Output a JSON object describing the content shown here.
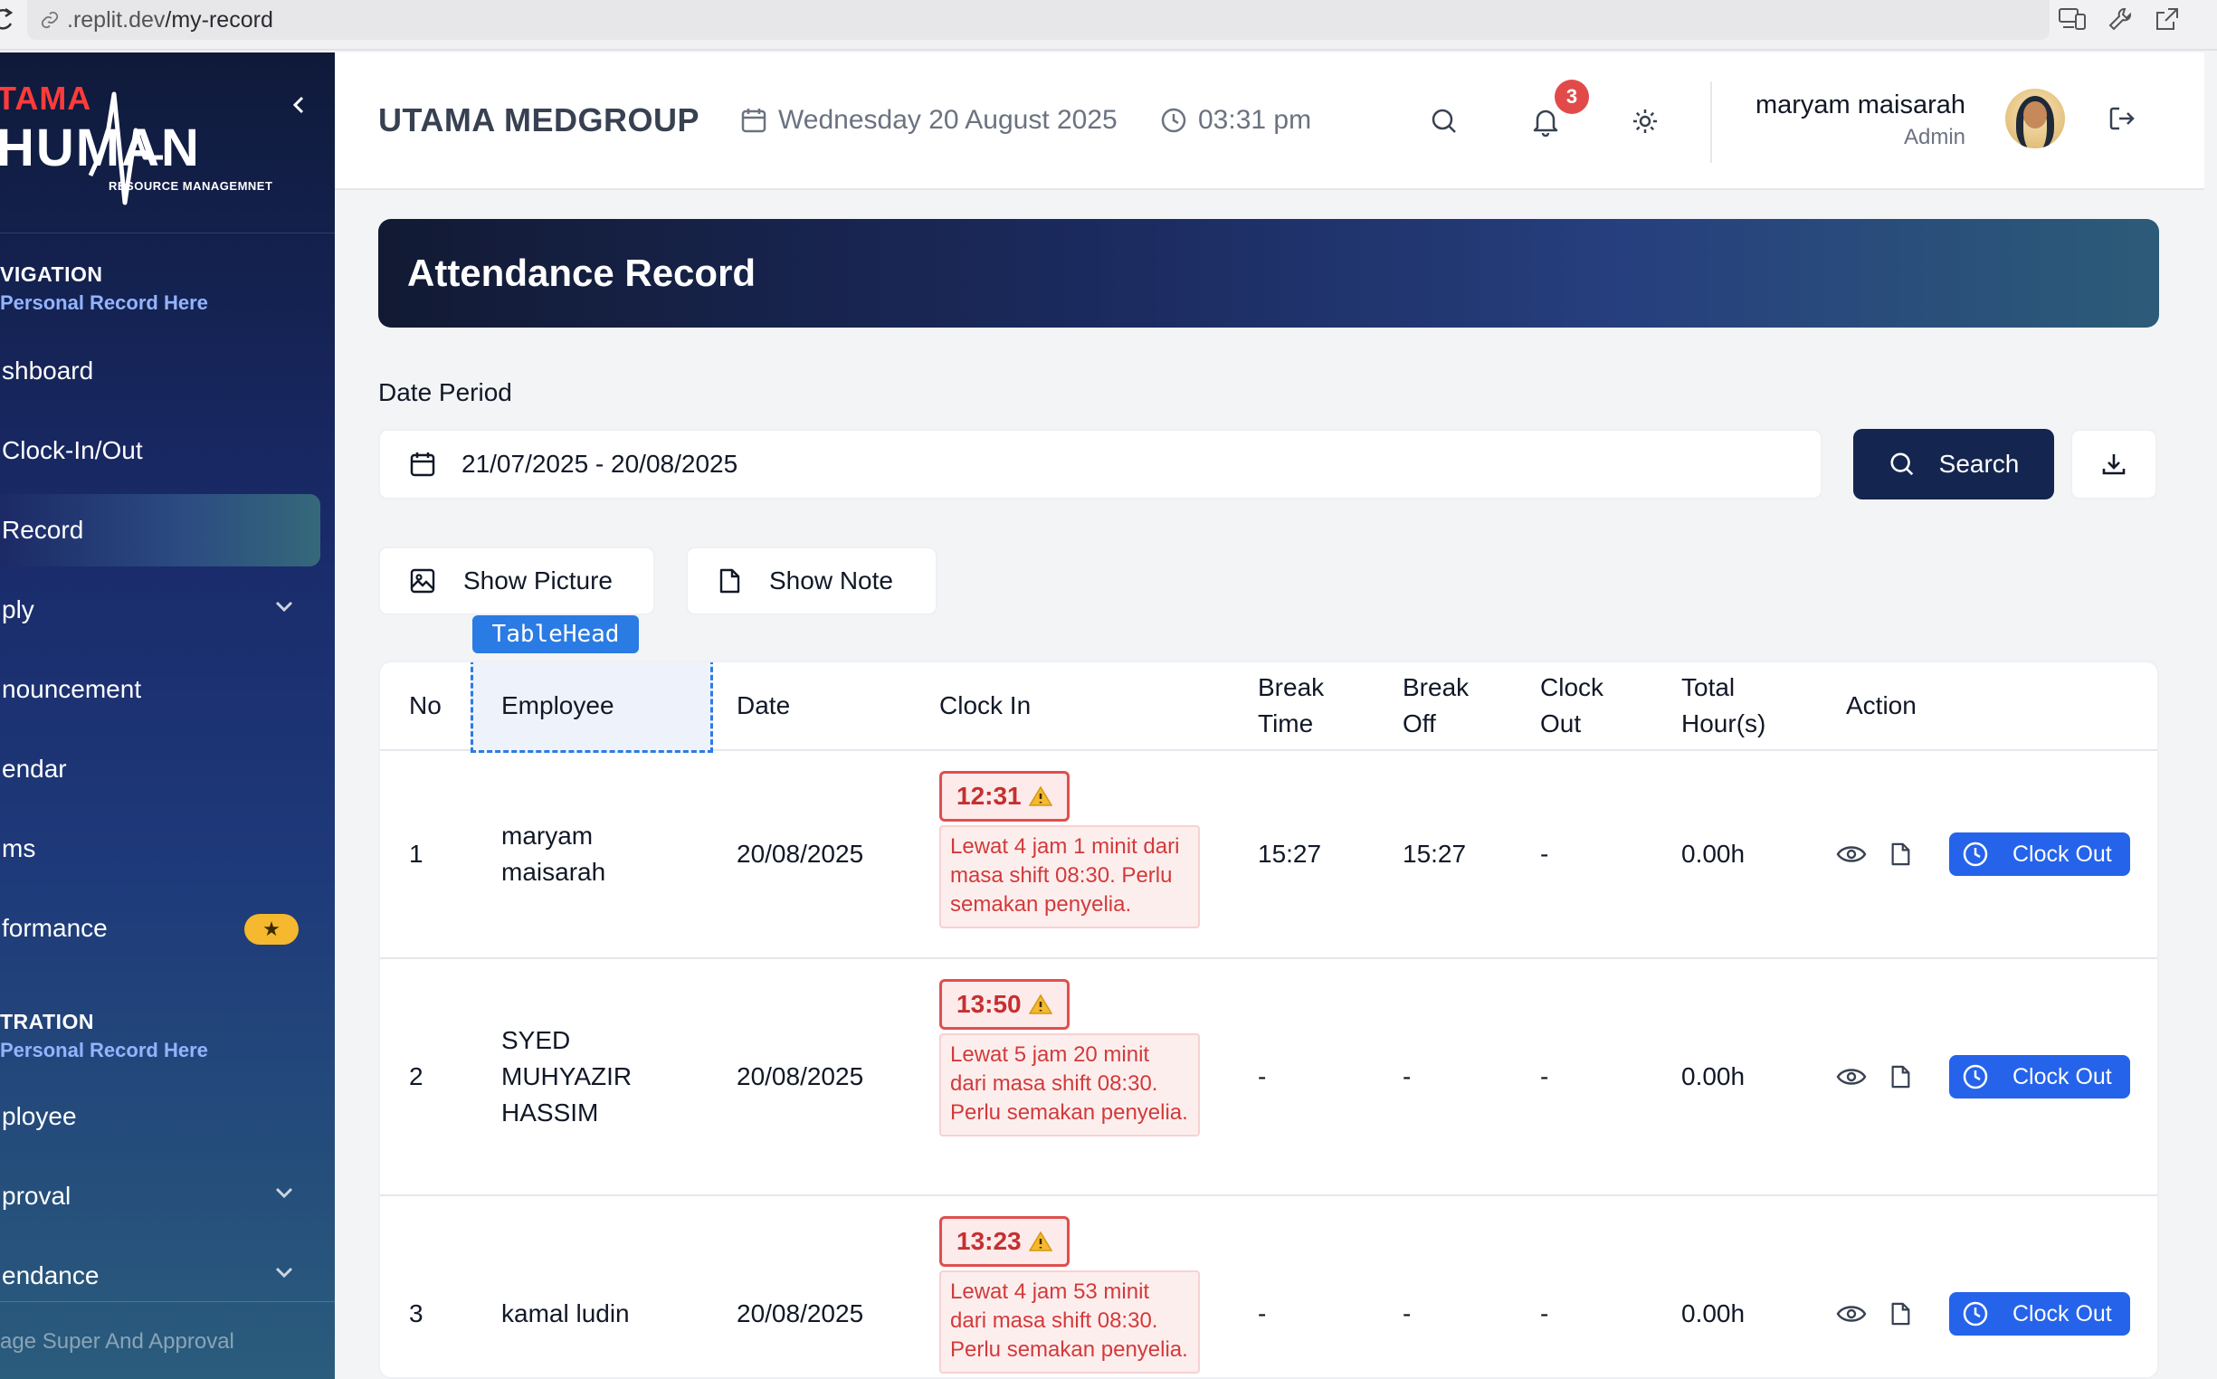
{
  "browser": {
    "url_prefix": ".replit.dev",
    "url_path": "/my-record"
  },
  "sidebar": {
    "brand": {
      "top": "TAMA",
      "main": "HUMAN",
      "sub": "RESOURCE MANAGEMNET"
    },
    "nav_title": "VIGATION",
    "nav_subtitle": "Personal Record Here",
    "items": [
      {
        "label": "shboard"
      },
      {
        "label": "Clock-In/Out"
      },
      {
        "label": "Record",
        "active": true
      },
      {
        "label": "ply",
        "has_chevron": true
      },
      {
        "label": "nouncement"
      },
      {
        "label": "endar"
      },
      {
        "label": "ms"
      },
      {
        "label": "formance",
        "badge_icon": "star-icon"
      }
    ],
    "admin_title": "TRATION",
    "admin_subtitle": "Personal Record Here",
    "admin_items": [
      {
        "label": "ployee"
      },
      {
        "label": "proval",
        "has_chevron": true
      },
      {
        "label": "endance",
        "has_chevron": true
      }
    ],
    "footer": "age Super And Approval"
  },
  "header": {
    "company": "UTAMA MEDGROUP",
    "date": "Wednesday 20 August 2025",
    "time": "03:31 pm",
    "notifications": "3",
    "user_name": "maryam maisarah",
    "user_role": "Admin"
  },
  "page": {
    "title": "Attendance Record",
    "date_period_label": "Date Period",
    "date_range": "21/07/2025 - 20/08/2025",
    "search_label": "Search",
    "show_picture_label": "Show Picture",
    "show_note_label": "Show Note",
    "dev_overlay_label": "TableHead"
  },
  "table": {
    "headers": {
      "no": "No",
      "employee": "Employee",
      "date": "Date",
      "clock_in": "Clock In",
      "break_time_1": "Break",
      "break_time_2": "Time",
      "break_off_1": "Break",
      "break_off_2": "Off",
      "clock_out_1": "Clock",
      "clock_out_2": "Out",
      "total_1": "Total",
      "total_2": "Hour(s)",
      "action": "Action"
    },
    "rows": [
      {
        "no": "1",
        "employee_lines": [
          "maryam",
          "maisarah"
        ],
        "date": "20/08/2025",
        "clock_in": "12:31",
        "note": "Lewat 4 jam 1 minit dari masa shift 08:30. Perlu semakan penyelia.",
        "break_time": "15:27",
        "break_off": "15:27",
        "clock_out": "-",
        "total": "0.00h",
        "action_label": "Clock Out"
      },
      {
        "no": "2",
        "employee_lines": [
          "SYED",
          "MUHYAZIR",
          "HASSIM"
        ],
        "date": "20/08/2025",
        "clock_in": "13:50",
        "note": "Lewat 5 jam 20 minit dari masa shift 08:30. Perlu semakan penyelia.",
        "break_time": "-",
        "break_off": "-",
        "clock_out": "-",
        "total": "0.00h",
        "action_label": "Clock Out"
      },
      {
        "no": "3",
        "employee_lines": [
          "kamal ludin"
        ],
        "date": "20/08/2025",
        "clock_in": "13:23",
        "note": "Lewat 4 jam 53 minit dari masa shift 08:30. Perlu semakan penyelia.",
        "break_time": "-",
        "break_off": "-",
        "clock_out": "-",
        "total": "0.00h",
        "action_label": "Clock Out"
      }
    ]
  },
  "colors": {
    "primary_dark": "#14254f",
    "accent_blue": "#2563eb",
    "late_red": "#c53030",
    "notif_red": "#e24a4a",
    "star_yellow": "#f5b82e"
  }
}
